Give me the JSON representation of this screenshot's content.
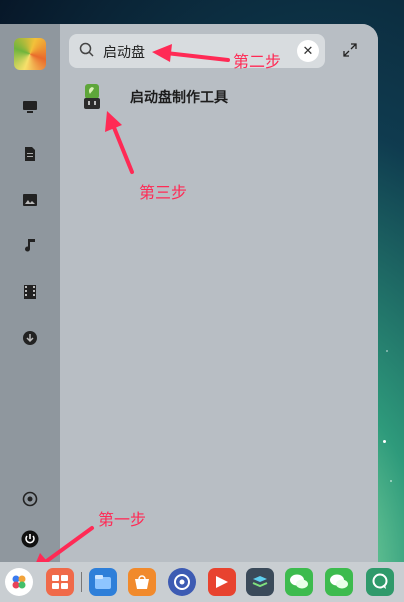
{
  "search": {
    "query": "启动盘",
    "clear_symbol": "✕"
  },
  "results": [
    {
      "label": "启动盘制作工具",
      "icon": "usb-drive-icon"
    }
  ],
  "sidebar": {
    "items": [
      {
        "name": "computer-icon"
      },
      {
        "name": "document-icon"
      },
      {
        "name": "picture-icon"
      },
      {
        "name": "music-icon"
      },
      {
        "name": "video-icon"
      },
      {
        "name": "download-icon"
      },
      {
        "name": "settings-icon"
      },
      {
        "name": "power-icon"
      }
    ]
  },
  "annotations": {
    "step1": "第一步",
    "step2": "第二步",
    "step3": "第三步",
    "color": "#ff2a55"
  },
  "dock": {
    "items": [
      {
        "name": "launcher-icon",
        "color": "#ffffff"
      },
      {
        "name": "multitask-view-icon",
        "color": "#f06a4a"
      },
      {
        "name": "file-manager-icon",
        "color": "#2e7fd9"
      },
      {
        "name": "app-store-icon",
        "color": "#f18a2c"
      },
      {
        "name": "control-center-icon",
        "color": "#3d5bb3"
      },
      {
        "name": "presentation-icon",
        "color": "#e8432f"
      },
      {
        "name": "stack-app-icon",
        "color": "#3a4a5a"
      },
      {
        "name": "wechat-icon",
        "color": "#3dbb4e"
      },
      {
        "name": "wechat-work-icon",
        "color": "#3dbb4e"
      },
      {
        "name": "chat-app-icon",
        "color": "#2f9a6b"
      }
    ]
  }
}
